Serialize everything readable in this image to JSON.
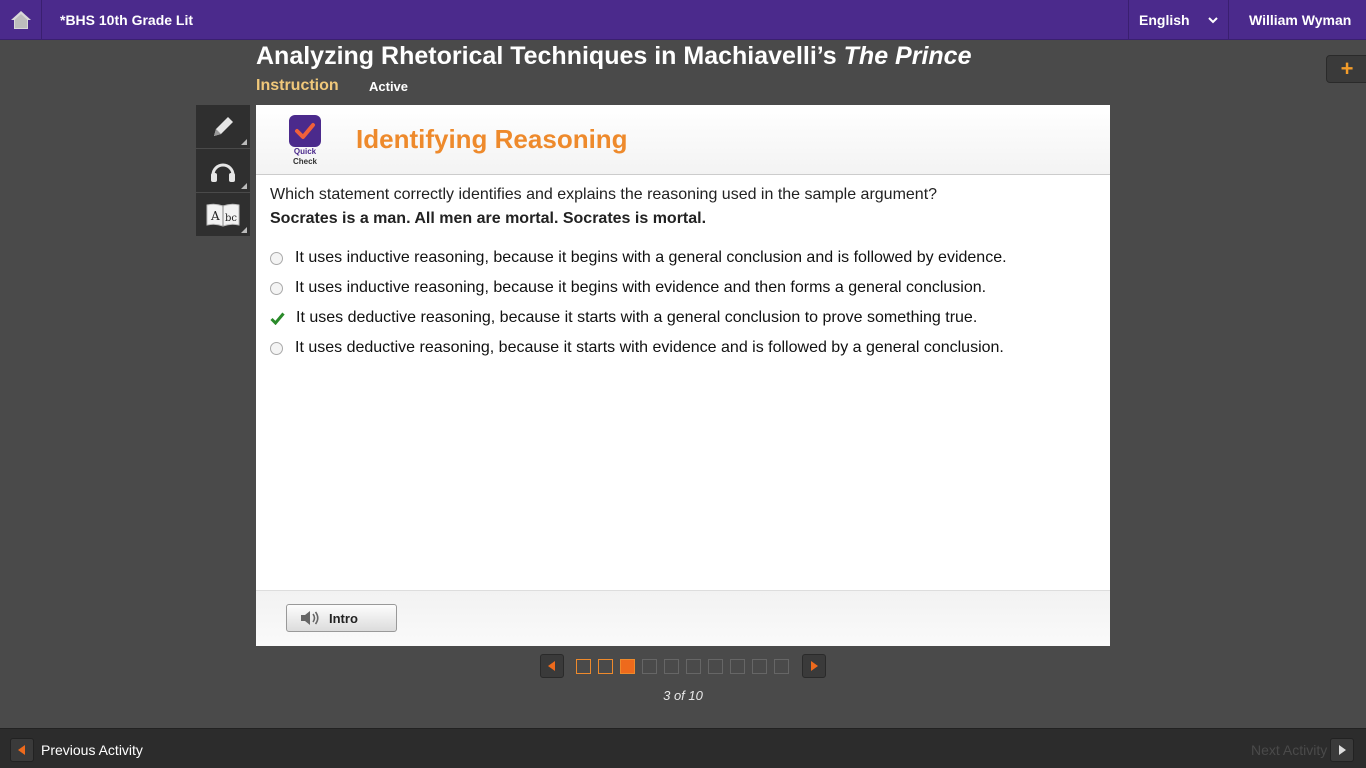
{
  "topbar": {
    "course_title": "*BHS 10th Grade Lit",
    "language": "English",
    "user_name": "William Wyman"
  },
  "header": {
    "title_prefix": "Analyzing Rhetorical Techniques in Machiavelli’s ",
    "title_italic": "The Prince",
    "section_label": "Instruction",
    "status": "Active",
    "add_label": "+"
  },
  "panel": {
    "badge_line1": "Quick",
    "badge_line2": "Check",
    "title": "Identifying Reasoning",
    "question": "Which statement correctly identifies and explains the reasoning used in the sample argument?",
    "premise": "Socrates is a man. All men are mortal. Socrates is mortal.",
    "answers": [
      {
        "text": "It uses inductive reasoning, because it begins with a general conclusion and is followed by evidence.",
        "state": "unselected"
      },
      {
        "text": "It uses inductive reasoning, because it begins with evidence and then forms a general conclusion.",
        "state": "unselected"
      },
      {
        "text": "It uses deductive reasoning, because it starts with a general conclusion to prove something true.",
        "state": "correct"
      },
      {
        "text": "It uses deductive reasoning, because it starts with evidence and is followed by a general conclusion.",
        "state": "unselected"
      }
    ],
    "intro_button": "Intro"
  },
  "pager": {
    "current": 3,
    "total": 10,
    "count_text": "3 of 10"
  },
  "bottombar": {
    "previous_label": "Previous Activity",
    "next_label": "Next Activity"
  },
  "colors": {
    "brand_purple": "#4b2a8c",
    "accent_orange": "#ee8a2c",
    "correct_green": "#2a8a2a"
  }
}
